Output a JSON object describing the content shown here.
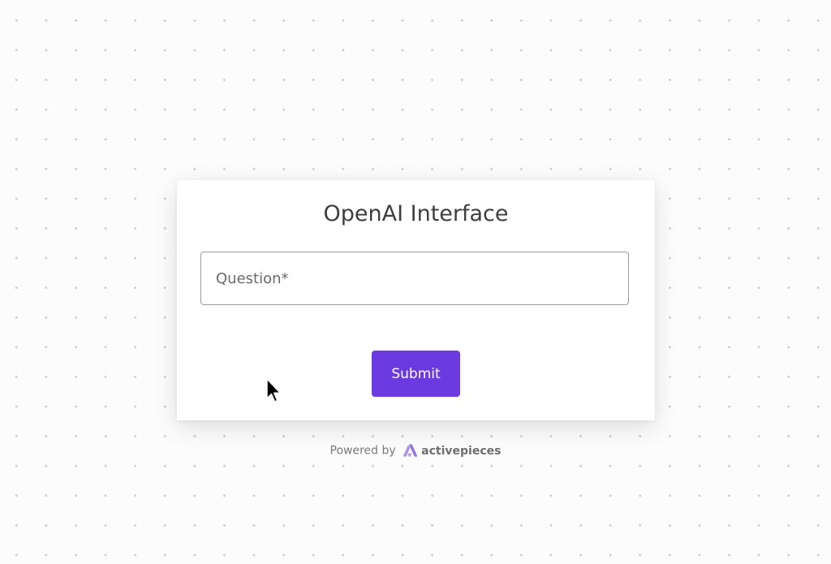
{
  "form": {
    "title": "OpenAI Interface",
    "question_placeholder": "Question*",
    "question_value": "",
    "submit_label": "Submit"
  },
  "footer": {
    "powered_by": "Powered by",
    "brand": "activepieces",
    "brand_icon": "activepieces-logo-icon"
  },
  "colors": {
    "accent": "#6b3ae0",
    "brand_logo": "#a994e8"
  }
}
